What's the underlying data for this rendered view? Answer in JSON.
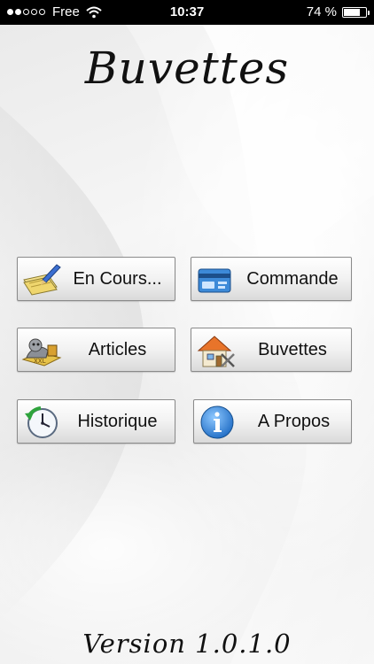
{
  "status_bar": {
    "carrier": "Free",
    "time": "10:37",
    "battery": "74 %",
    "battery_level": 0.74,
    "signal_bars_filled": 2,
    "signal_bars_total": 5
  },
  "app": {
    "title": "Buvettes",
    "version": "Version 1.0.1.0"
  },
  "menu": {
    "en_cours": {
      "label": "En Cours...",
      "icon": "notepad-pencil-icon"
    },
    "commande": {
      "label": "Commande",
      "icon": "order-card-icon"
    },
    "articles": {
      "label": "Articles",
      "icon": "articles-items-icon"
    },
    "buvettes": {
      "label": "Buvettes",
      "icon": "house-tools-icon"
    },
    "historique": {
      "label": "Historique",
      "icon": "clock-history-icon"
    },
    "a_propos": {
      "label": "A Propos",
      "icon": "info-icon"
    }
  },
  "colors": {
    "status_bar_bg": "#000000",
    "info_blue": "#2a7fd4",
    "house_roof": "#e8742a"
  }
}
